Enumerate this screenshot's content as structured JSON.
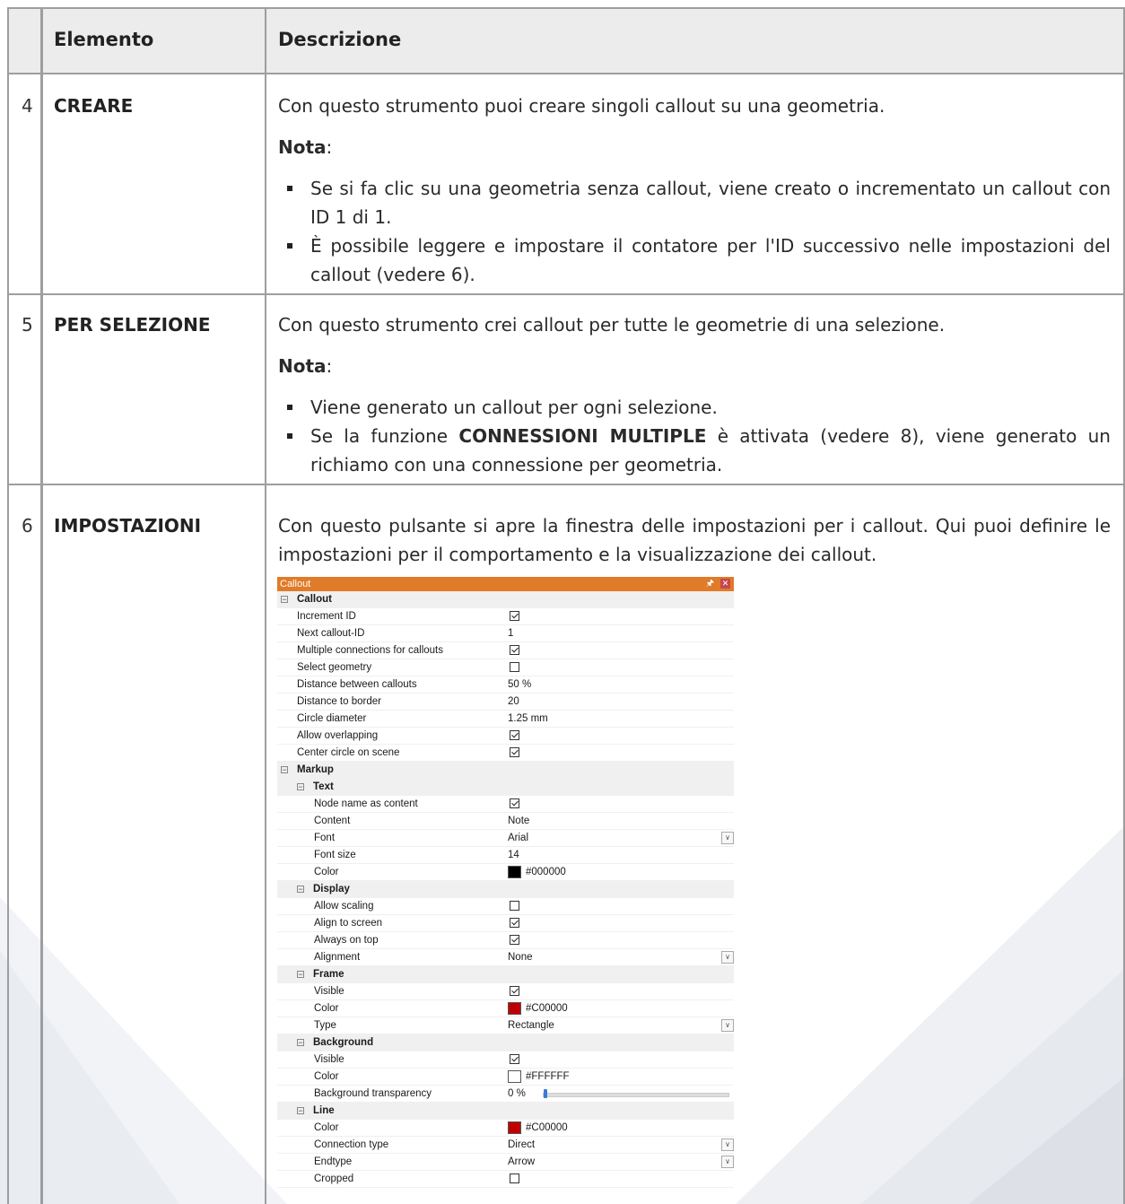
{
  "table": {
    "headers": {
      "element": "Elemento",
      "description": "Descrizione"
    },
    "rows": [
      {
        "number": "4",
        "term": "CREARE",
        "intro": "Con questo strumento puoi creare singoli callout su una geometria.",
        "note_label": "Nota",
        "note_colon": ":",
        "bullets": [
          "Se si fa clic su una geometria senza callout, viene creato o incrementato un callout con ID 1 di 1.",
          "È possibile leggere e impostare il contatore per l'ID successivo nelle impostazioni del callout (vedere 6)."
        ]
      },
      {
        "number": "5",
        "term": "PER SELEZIONE",
        "intro": "Con questo strumento crei callout per tutte le geometrie di una selezione.",
        "note_label": "Nota",
        "note_colon": ":",
        "bullet1": "Viene generato un callout per ogni selezione.",
        "bullet2_pre": "Se la funzione ",
        "bullet2_bold": "CONNESSIONI MULTIPLE",
        "bullet2_post": " è attivata (vedere 8), viene generato un richiamo con una connessione per geometria."
      },
      {
        "number": "6",
        "term": "IMPOSTAZIONI",
        "intro": "Con questo pulsante si apre la finestra delle impostazioni per i callout. Qui puoi definire le impostazioni per il comportamento e la visualizzazione dei callout."
      }
    ]
  },
  "panel": {
    "title": "Callout",
    "pin_icon": "pin-icon",
    "close_icon": "close-icon",
    "accent_color": "#E07B29",
    "rows": [
      {
        "type": "cat",
        "level": 0,
        "name": "Callout"
      },
      {
        "type": "check",
        "level": 1,
        "name": "Increment ID",
        "checked": true
      },
      {
        "type": "text",
        "level": 1,
        "name": "Next callout-ID",
        "value": "1"
      },
      {
        "type": "check",
        "level": 1,
        "name": "Multiple connections for callouts",
        "checked": true
      },
      {
        "type": "check",
        "level": 1,
        "name": "Select geometry",
        "checked": false
      },
      {
        "type": "text",
        "level": 1,
        "name": "Distance between callouts",
        "value": "50 %"
      },
      {
        "type": "text",
        "level": 1,
        "name": "Distance to border",
        "value": "20"
      },
      {
        "type": "text",
        "level": 1,
        "name": "Circle diameter",
        "value": "1.25 mm"
      },
      {
        "type": "check",
        "level": 1,
        "name": "Allow overlapping",
        "checked": true
      },
      {
        "type": "check",
        "level": 1,
        "name": "Center circle on scene",
        "checked": true
      },
      {
        "type": "cat",
        "level": 0,
        "name": "Markup"
      },
      {
        "type": "cat",
        "level": 1,
        "name": "Text"
      },
      {
        "type": "check",
        "level": 2,
        "name": "Node name as content",
        "checked": true
      },
      {
        "type": "text",
        "level": 2,
        "name": "Content",
        "value": "Note"
      },
      {
        "type": "select",
        "level": 2,
        "name": "Font",
        "value": "Arial"
      },
      {
        "type": "text",
        "level": 2,
        "name": "Font size",
        "value": "14"
      },
      {
        "type": "color",
        "level": 2,
        "name": "Color",
        "value": "#000000",
        "swatch": "#000000"
      },
      {
        "type": "cat",
        "level": 1,
        "name": "Display"
      },
      {
        "type": "check",
        "level": 2,
        "name": "Allow scaling",
        "checked": false
      },
      {
        "type": "check",
        "level": 2,
        "name": "Align to screen",
        "checked": true
      },
      {
        "type": "check",
        "level": 2,
        "name": "Always on top",
        "checked": true
      },
      {
        "type": "select",
        "level": 2,
        "name": "Alignment",
        "value": "None"
      },
      {
        "type": "cat",
        "level": 1,
        "name": "Frame"
      },
      {
        "type": "check",
        "level": 2,
        "name": "Visible",
        "checked": true
      },
      {
        "type": "color",
        "level": 2,
        "name": "Color",
        "value": "#C00000",
        "swatch": "#C00000"
      },
      {
        "type": "select",
        "level": 2,
        "name": "Type",
        "value": "Rectangle"
      },
      {
        "type": "cat",
        "level": 1,
        "name": "Background"
      },
      {
        "type": "check",
        "level": 2,
        "name": "Visible",
        "checked": true
      },
      {
        "type": "color",
        "level": 2,
        "name": "Color",
        "value": "#FFFFFF",
        "swatch": "#FFFFFF"
      },
      {
        "type": "slider",
        "level": 2,
        "name": "Background transparency",
        "value": "0 %",
        "fraction": 0
      },
      {
        "type": "cat",
        "level": 1,
        "name": "Line"
      },
      {
        "type": "color",
        "level": 2,
        "name": "Color",
        "value": "#C00000",
        "swatch": "#C00000"
      },
      {
        "type": "select",
        "level": 2,
        "name": "Connection type",
        "value": "Direct"
      },
      {
        "type": "select",
        "level": 2,
        "name": "Endtype",
        "value": "Arrow"
      },
      {
        "type": "check",
        "level": 2,
        "name": "Cropped",
        "checked": false
      }
    ]
  }
}
